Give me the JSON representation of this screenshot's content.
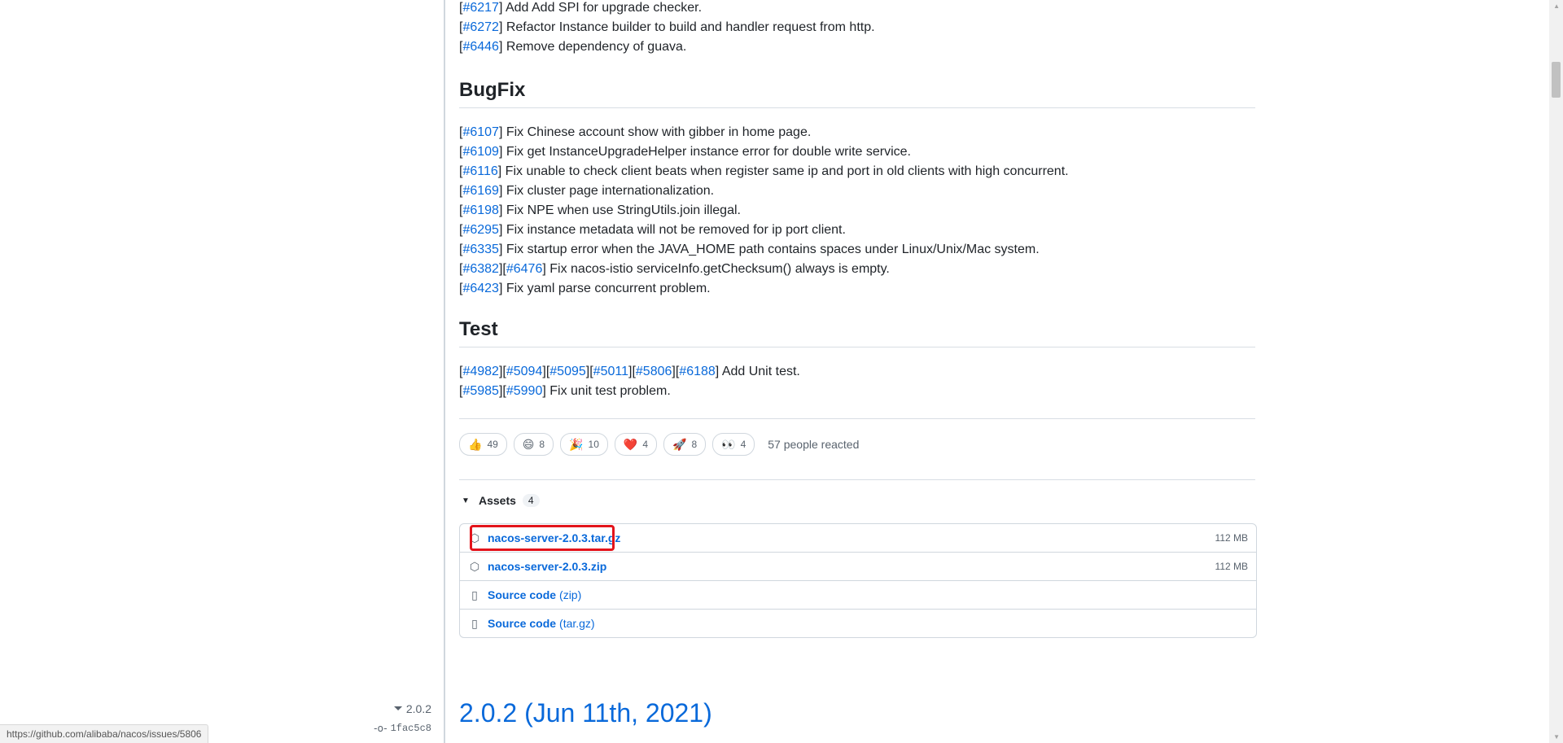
{
  "top_items": [
    {
      "refs": [
        "#6217"
      ],
      "text": " Add Add SPI for upgrade checker."
    },
    {
      "refs": [
        "#6272"
      ],
      "text": " Refactor Instance builder to build and handler request from http."
    },
    {
      "refs": [
        "#6446"
      ],
      "text": " Remove dependency of guava."
    }
  ],
  "bugfix": {
    "heading": "BugFix",
    "items": [
      {
        "refs": [
          "#6107"
        ],
        "text": " Fix Chinese account show with gibber in home page."
      },
      {
        "refs": [
          "#6109"
        ],
        "text": " Fix get InstanceUpgradeHelper instance error for double write service."
      },
      {
        "refs": [
          "#6116"
        ],
        "text": " Fix unable to check client beats when register same ip and port in old clients with high concurrent."
      },
      {
        "refs": [
          "#6169"
        ],
        "text": " Fix cluster page internationalization."
      },
      {
        "refs": [
          "#6198"
        ],
        "text": " Fix NPE when use StringUtils.join illegal."
      },
      {
        "refs": [
          "#6295"
        ],
        "text": " Fix instance metadata will not be removed for ip port client."
      },
      {
        "refs": [
          "#6335"
        ],
        "text": " Fix startup error when the JAVA_HOME path contains spaces under Linux/Unix/Mac system."
      },
      {
        "refs": [
          "#6382",
          "#6476"
        ],
        "text": " Fix nacos-istio serviceInfo.getChecksum() always is empty."
      },
      {
        "refs": [
          "#6423"
        ],
        "text": " Fix yaml parse concurrent problem."
      }
    ]
  },
  "test": {
    "heading": "Test",
    "items": [
      {
        "refs": [
          "#4982",
          "#5094",
          "#5095",
          "#5011",
          "#5806",
          "#6188"
        ],
        "text": " Add Unit test."
      },
      {
        "refs": [
          "#5985",
          "#5990"
        ],
        "text": " Fix unit test problem."
      }
    ]
  },
  "reactions": {
    "items": [
      {
        "emoji": "👍",
        "icon": "thumbs-up-icon",
        "count": "49"
      },
      {
        "emoji": "😄",
        "icon": "laugh-icon",
        "count": "8"
      },
      {
        "emoji": "🎉",
        "icon": "hooray-icon",
        "count": "10"
      },
      {
        "emoji": "❤️",
        "icon": "heart-icon",
        "count": "4"
      },
      {
        "emoji": "🚀",
        "icon": "rocket-icon",
        "count": "8"
      },
      {
        "emoji": "👀",
        "icon": "eyes-icon",
        "count": "4"
      }
    ],
    "summary": "57 people reacted"
  },
  "assets": {
    "label": "Assets",
    "count": "4",
    "items": [
      {
        "name": "nacos-server-2.0.3.tar.gz",
        "suffix": "",
        "size": "112 MB",
        "icon": "package-icon"
      },
      {
        "name": "nacos-server-2.0.3.zip",
        "suffix": "",
        "size": "112 MB",
        "icon": "package-icon"
      },
      {
        "name": "Source code",
        "suffix": "(zip)",
        "size": "",
        "icon": "file-zip-icon"
      },
      {
        "name": "Source code",
        "suffix": "(tar.gz)",
        "size": "",
        "icon": "file-zip-icon"
      }
    ]
  },
  "next_release": {
    "tag": "2.0.2",
    "commit": "1fac5c8",
    "title": "2.0.2 (Jun 11th, 2021)"
  },
  "status_url": "https://github.com/alibaba/nacos/issues/5806",
  "colors": {
    "link": "#0969da",
    "highlight_box": "#e3141b"
  }
}
